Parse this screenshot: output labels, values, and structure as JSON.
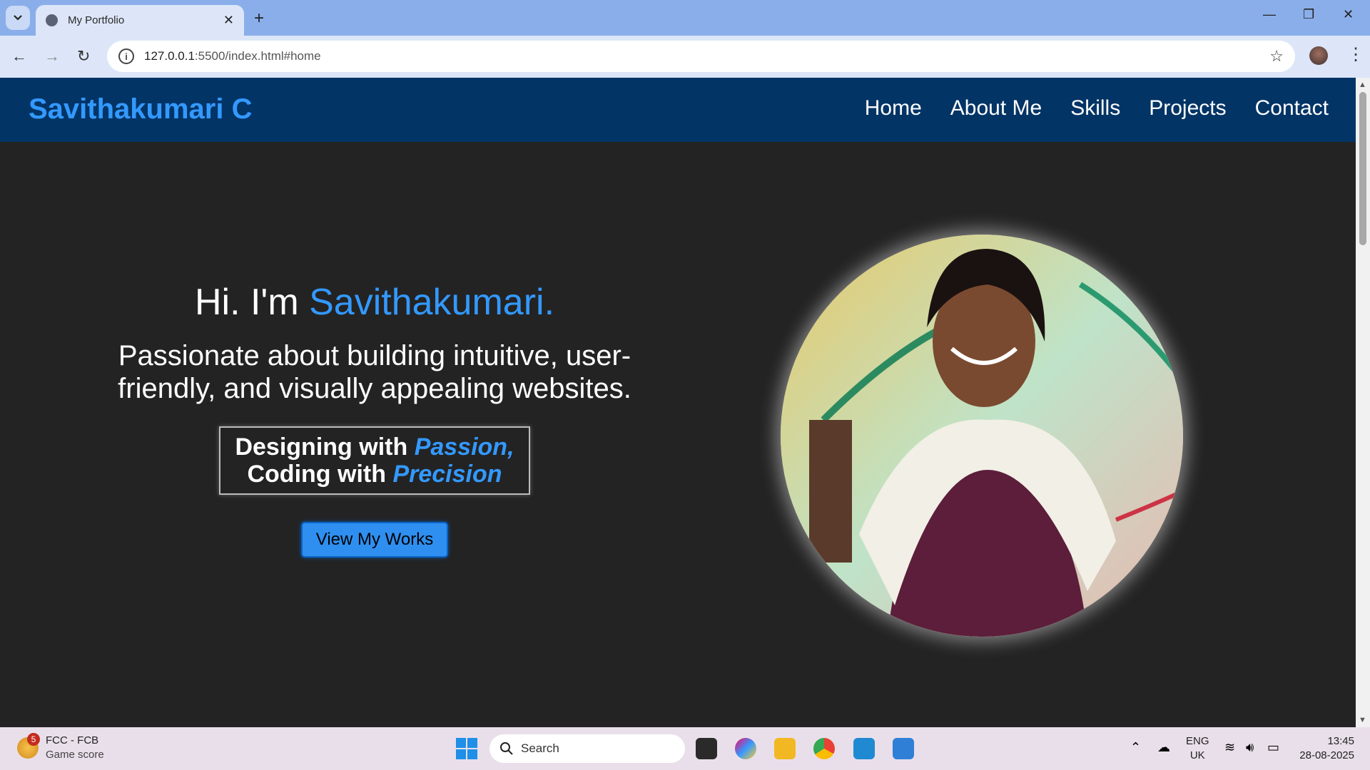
{
  "browser": {
    "tab_title": "My Portfolio",
    "tab_close": "✕",
    "new_tab": "+",
    "url_host": "127.0.0.1",
    "url_rest": ":5500/index.html#home",
    "minimize": "—",
    "restore": "❐",
    "close": "✕"
  },
  "site": {
    "brand": "Savithakumari C",
    "nav": [
      "Home",
      "About Me",
      "Skills",
      "Projects",
      "Contact"
    ]
  },
  "hero": {
    "greeting_prefix": "Hi. I'm ",
    "greeting_name": "Savithakumari.",
    "tagline": "Passionate about building intuitive, user-friendly, and visually appealing websites.",
    "motto_line1_prefix": "Designing with ",
    "motto_line1_em": "Passion,",
    "motto_line2_prefix": "Coding with ",
    "motto_line2_em": "Precision",
    "cta_label": "View My Works"
  },
  "taskbar": {
    "weather_badge": "5",
    "weather_title": "FCC - FCB",
    "weather_sub": "Game score",
    "search_placeholder": "Search",
    "lang_top": "ENG",
    "lang_bottom": "UK",
    "time": "13:45",
    "date": "28-08-2025"
  },
  "colors": {
    "accent": "#3399ff",
    "nav_bg": "#023466",
    "page_bg": "#232323"
  }
}
